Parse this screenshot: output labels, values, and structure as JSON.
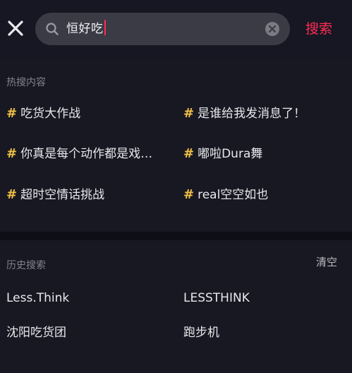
{
  "header": {
    "search_value": "恒好吃",
    "search_button_label": "搜索",
    "close_icon": "close-icon",
    "search_icon": "search-icon",
    "clear_icon": "clear-circle-icon",
    "accent_color": "#ff2c55"
  },
  "hot": {
    "label": "热搜内容",
    "hash_symbol": "#",
    "items": [
      {
        "text": "吃货大作战"
      },
      {
        "text": "是谁给我发消息了！"
      },
      {
        "text": "你真是每个动作都是戏…"
      },
      {
        "text": "嘟啦Dura舞"
      },
      {
        "text": "超时空情话挑战"
      },
      {
        "text": "real空空如也"
      }
    ]
  },
  "history": {
    "label": "历史搜索",
    "clear_label": "清空",
    "items": [
      {
        "text": "Less.Think"
      },
      {
        "text": "LESSTHINK"
      },
      {
        "text": "沈阳吃货团"
      },
      {
        "text": "跑步机"
      }
    ]
  }
}
